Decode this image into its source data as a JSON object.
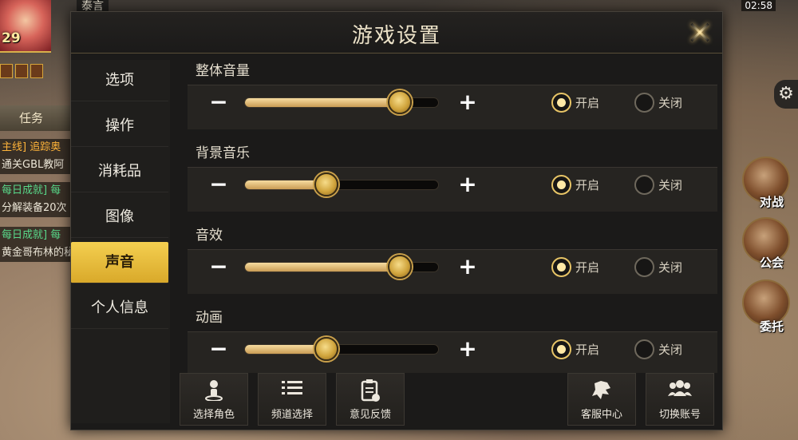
{
  "dialog": {
    "title": "游戏设置"
  },
  "menu": [
    {
      "label": "选项"
    },
    {
      "label": "操作"
    },
    {
      "label": "消耗品"
    },
    {
      "label": "图像"
    },
    {
      "label": "声音",
      "active": true
    },
    {
      "label": "个人信息"
    }
  ],
  "sound": {
    "sections": [
      {
        "title": "整体音量",
        "level": 0.8,
        "enabled": true
      },
      {
        "title": "背景音乐",
        "level": 0.42,
        "enabled": true
      },
      {
        "title": "音效",
        "level": 0.8,
        "enabled": true
      },
      {
        "title": "动画",
        "level": 0.42,
        "enabled": true
      }
    ],
    "minus_label": "−",
    "plus_label": "+",
    "on_label": "开启",
    "off_label": "关闭"
  },
  "bottom_buttons": [
    {
      "label": "选择角色",
      "icon": "person-pin-icon"
    },
    {
      "label": "频道选择",
      "icon": "list-icon"
    },
    {
      "label": "意见反馈",
      "icon": "clipboard-icon"
    },
    {
      "label": "客服中心",
      "icon": "support-icon"
    },
    {
      "label": "切换账号",
      "icon": "users-icon"
    }
  ],
  "hud": {
    "player_name": "泰言",
    "level": "29",
    "clock": "02:58",
    "task_tab": "任务",
    "quests": [
      {
        "text": "主线] 追踪奥",
        "color": "gold"
      },
      {
        "text": "通关GBL教阿",
        "color": "white"
      },
      {
        "text": "每日成就] 每",
        "color": "green"
      },
      {
        "text": "分解装备20次",
        "color": "white"
      },
      {
        "text": "每日成就] 每",
        "color": "green"
      },
      {
        "text": "黄金哥布林的秘",
        "color": "white"
      }
    ],
    "right_buttons": [
      {
        "label": "对战"
      },
      {
        "label": "公会"
      },
      {
        "label": "委托"
      }
    ]
  }
}
